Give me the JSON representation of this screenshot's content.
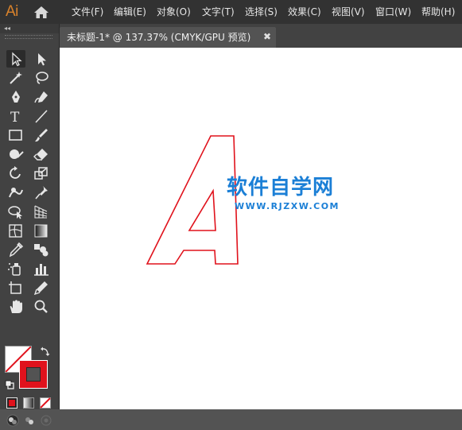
{
  "app": {
    "logo_text": "Ai",
    "logo_color": "#d9822b",
    "home_icon": "home-icon"
  },
  "menu": [
    {
      "label": "文件(F)"
    },
    {
      "label": "编辑(E)"
    },
    {
      "label": "对象(O)"
    },
    {
      "label": "文字(T)"
    },
    {
      "label": "选择(S)"
    },
    {
      "label": "效果(C)"
    },
    {
      "label": "视图(V)"
    },
    {
      "label": "窗口(W)"
    },
    {
      "label": "帮助(H)"
    }
  ],
  "document_tab": {
    "label": "未标题-1* @ 137.37% (CMYK/GPU 预览)",
    "close_label": "✖"
  },
  "toolbar": {
    "collapse_label": "◂◂",
    "tools": [
      {
        "name": "selection-tool",
        "icon": "selection-arrow-icon",
        "selected": true
      },
      {
        "name": "direct-selection-tool",
        "icon": "direct-selection-arrow-icon"
      },
      {
        "name": "magic-wand-tool",
        "icon": "magic-wand-icon"
      },
      {
        "name": "lasso-tool",
        "icon": "lasso-icon"
      },
      {
        "name": "pen-tool",
        "icon": "pen-icon"
      },
      {
        "name": "curvature-tool",
        "icon": "curvature-pen-icon"
      },
      {
        "name": "type-tool",
        "icon": "type-icon",
        "glyph": "T"
      },
      {
        "name": "line-segment-tool",
        "icon": "line-segment-icon"
      },
      {
        "name": "rectangle-tool",
        "icon": "rectangle-icon"
      },
      {
        "name": "paintbrush-tool",
        "icon": "paintbrush-icon"
      },
      {
        "name": "shaper-tool",
        "icon": "shaper-icon"
      },
      {
        "name": "eraser-tool",
        "icon": "eraser-icon"
      },
      {
        "name": "rotate-tool",
        "icon": "rotate-icon"
      },
      {
        "name": "scale-tool",
        "icon": "scale-icon"
      },
      {
        "name": "warp-tool",
        "icon": "warp-icon"
      },
      {
        "name": "puppet-warp-tool",
        "icon": "puppet-warp-icon"
      },
      {
        "name": "shape-builder-tool",
        "icon": "shape-builder-icon"
      },
      {
        "name": "perspective-grid-tool",
        "icon": "perspective-grid-icon"
      },
      {
        "name": "mesh-tool",
        "icon": "mesh-icon"
      },
      {
        "name": "gradient-tool",
        "icon": "gradient-icon"
      },
      {
        "name": "eyedropper-tool",
        "icon": "eyedropper-icon"
      },
      {
        "name": "blend-tool",
        "icon": "blend-icon"
      },
      {
        "name": "symbol-sprayer-tool",
        "icon": "symbol-sprayer-icon"
      },
      {
        "name": "column-graph-tool",
        "icon": "column-graph-icon"
      },
      {
        "name": "artboard-tool",
        "icon": "artboard-icon"
      },
      {
        "name": "slice-tool",
        "icon": "slice-icon"
      },
      {
        "name": "hand-tool",
        "icon": "hand-icon"
      },
      {
        "name": "zoom-tool",
        "icon": "zoom-icon"
      }
    ],
    "fill_color": "none",
    "stroke_color": "#e0121c"
  },
  "canvas": {
    "background": "#ffffff",
    "artwork_stroke_color": "#e0121c",
    "watermark_title": "软件自学网",
    "watermark_url": "WWW.RJZXW.COM",
    "watermark_color": "#1b7fd6"
  }
}
